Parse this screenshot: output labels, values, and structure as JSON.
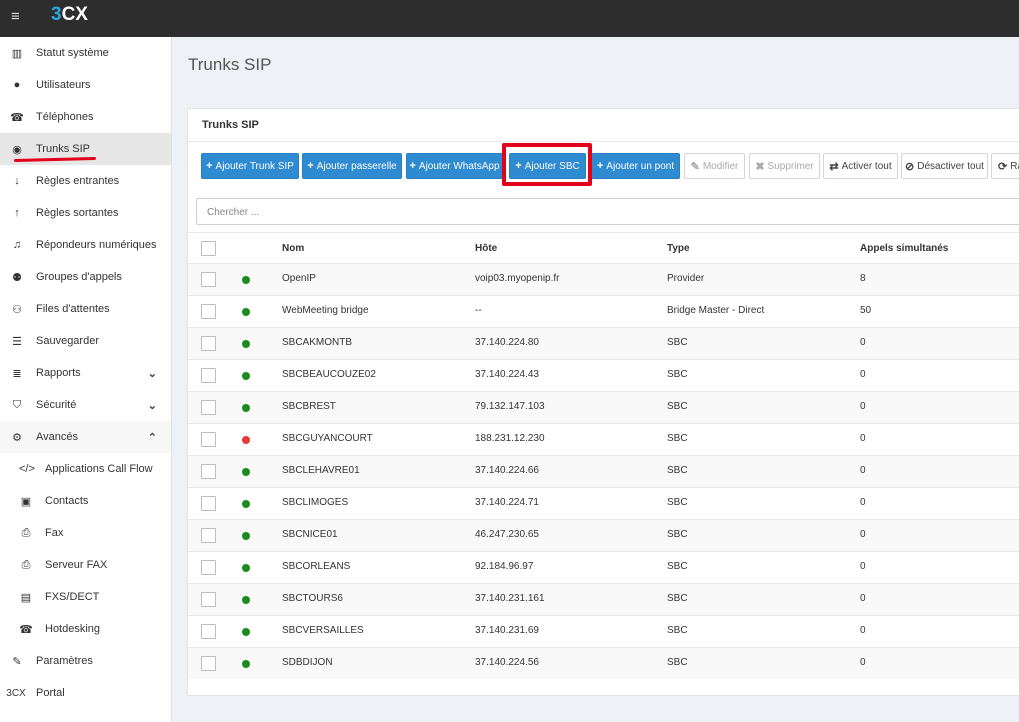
{
  "app": {
    "logo_prefix": "3",
    "logo_suffix": "CX",
    "menu_icon": "hamburger-icon"
  },
  "sidebar": {
    "items": [
      {
        "label": "Statut système",
        "icon": "bar-chart-icon"
      },
      {
        "label": "Utilisateurs",
        "icon": "user-icon"
      },
      {
        "label": "Téléphones",
        "icon": "phone-icon"
      },
      {
        "label": "Trunks SIP",
        "icon": "globe-icon",
        "active": true
      },
      {
        "label": "Règles entrantes",
        "icon": "arrow-down-icon"
      },
      {
        "label": "Règles sortantes",
        "icon": "arrow-up-icon"
      },
      {
        "label": "Répondeurs numériques",
        "icon": "headset-icon"
      },
      {
        "label": "Groupes d'appels",
        "icon": "users-icon"
      },
      {
        "label": "Files d'attentes",
        "icon": "queue-icon"
      },
      {
        "label": "Sauvegarder",
        "icon": "database-icon"
      },
      {
        "label": "Rapports",
        "icon": "list-icon",
        "chevron": "down"
      },
      {
        "label": "Sécurité",
        "icon": "shield-icon",
        "chevron": "down"
      },
      {
        "label": "Avancés",
        "icon": "gear-icon",
        "chevron": "up"
      },
      {
        "label": "Applications Call Flow",
        "icon": "code-icon",
        "sub": true
      },
      {
        "label": "Contacts",
        "icon": "contact-icon",
        "sub": true
      },
      {
        "label": "Fax",
        "icon": "fax-icon",
        "sub": true
      },
      {
        "label": "Serveur FAX",
        "icon": "fax-server-icon",
        "sub": true
      },
      {
        "label": "FXS/DECT",
        "icon": "fxs-icon",
        "sub": true
      },
      {
        "label": "Hotdesking",
        "icon": "desk-phone-icon",
        "sub": true
      },
      {
        "label": "Paramètres",
        "icon": "wrench-icon"
      },
      {
        "label": "Portal",
        "icon": "3cx-icon"
      }
    ]
  },
  "page": {
    "title": "Trunks SIP"
  },
  "panel": {
    "title": "Trunks SIP",
    "buttons": [
      {
        "label": "Ajouter Trunk SIP",
        "icon": "+",
        "style": "blue"
      },
      {
        "label": "Ajouter passerelle",
        "icon": "+",
        "style": "blue"
      },
      {
        "label": "Ajouter WhatsApp",
        "icon": "+",
        "style": "blue"
      },
      {
        "label": "Ajouter SBC",
        "icon": "+",
        "style": "blue"
      },
      {
        "label": "Ajouter un pont",
        "icon": "+",
        "style": "blue"
      },
      {
        "label": "Modifier",
        "icon": "✎",
        "style": "grey-disabled"
      },
      {
        "label": "Supprimer",
        "icon": "✖",
        "style": "grey-disabled"
      },
      {
        "label": "Activer tout",
        "icon": "⇄",
        "style": "grey"
      },
      {
        "label": "Désactiver tout",
        "icon": "⊘",
        "style": "grey"
      },
      {
        "label": "Ra",
        "icon": "⟳",
        "style": "grey"
      }
    ],
    "search_placeholder": "Chercher ...",
    "columns": [
      "Nom",
      "Hôte",
      "Type",
      "Appels simultanés"
    ],
    "rows": [
      {
        "status": "green",
        "name": "OpenIP",
        "host": "voip03.myopenip.fr",
        "type": "Provider",
        "calls": "8"
      },
      {
        "status": "green",
        "name": "WebMeeting bridge",
        "host": "--",
        "type": "Bridge Master - Direct",
        "calls": "50"
      },
      {
        "status": "green",
        "name": "SBCAKMONTB",
        "host": "37.140.224.80",
        "type": "SBC",
        "calls": "0"
      },
      {
        "status": "green",
        "name": "SBCBEAUCOUZE02",
        "host": "37.140.224.43",
        "type": "SBC",
        "calls": "0"
      },
      {
        "status": "green",
        "name": "SBCBREST",
        "host": "79.132.147.103",
        "type": "SBC",
        "calls": "0"
      },
      {
        "status": "red",
        "name": "SBCGUYANCOURT",
        "host": "188.231.12.230",
        "type": "SBC",
        "calls": "0"
      },
      {
        "status": "green",
        "name": "SBCLEHAVRE01",
        "host": "37.140.224.66",
        "type": "SBC",
        "calls": "0"
      },
      {
        "status": "green",
        "name": "SBCLIMOGES",
        "host": "37.140.224.71",
        "type": "SBC",
        "calls": "0"
      },
      {
        "status": "green",
        "name": "SBCNICE01",
        "host": "46.247.230.65",
        "type": "SBC",
        "calls": "0"
      },
      {
        "status": "green",
        "name": "SBCORLEANS",
        "host": "92.184.96.97",
        "type": "SBC",
        "calls": "0"
      },
      {
        "status": "green",
        "name": "SBCTOURS6",
        "host": "37.140.231.161",
        "type": "SBC",
        "calls": "0"
      },
      {
        "status": "green",
        "name": "SBCVERSAILLES",
        "host": "37.140.231.69",
        "type": "SBC",
        "calls": "0"
      },
      {
        "status": "green",
        "name": "SDBDIJON",
        "host": "37.140.224.56",
        "type": "SBC",
        "calls": "0"
      }
    ]
  },
  "colors": {
    "accent": "#2e8ad1",
    "status_green": "#1e8a1e",
    "status_red": "#e53935",
    "highlight": "#e4001b"
  }
}
